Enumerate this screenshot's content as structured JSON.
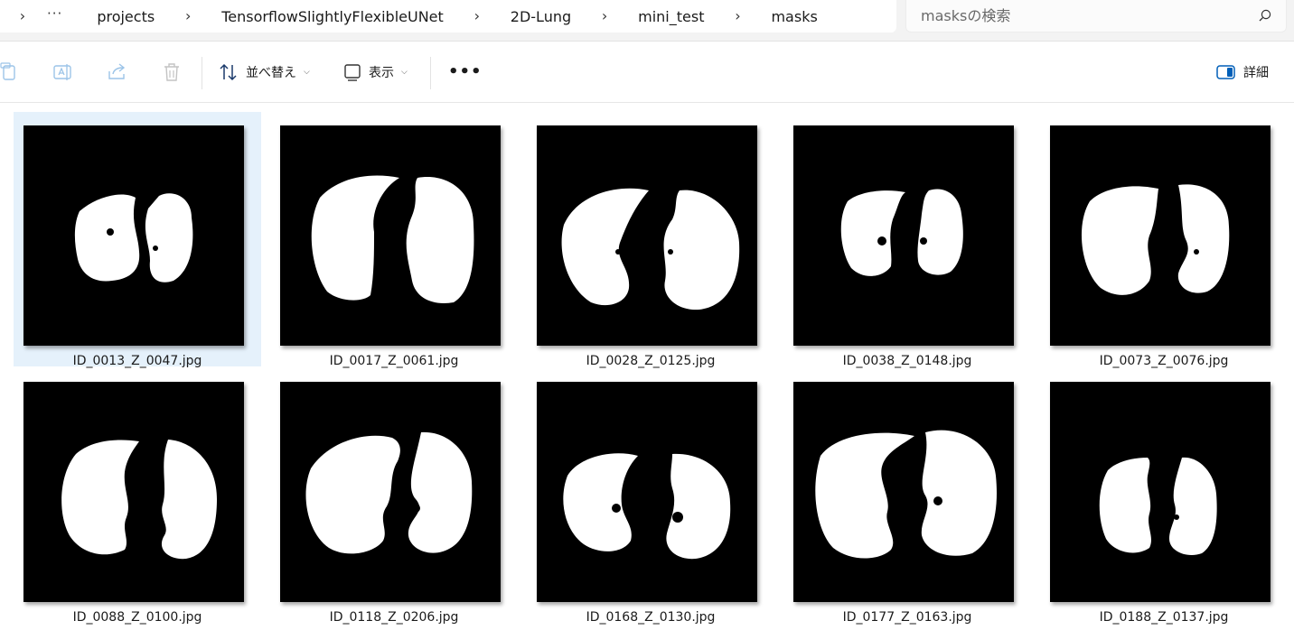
{
  "breadcrumb": {
    "overflow": "···",
    "segments": [
      "projects",
      "TensorflowSlightlyFlexibleUNet",
      "2D-Lung",
      "mini_test",
      "masks"
    ]
  },
  "search": {
    "placeholder": "masksの検索",
    "icon": "search-icon"
  },
  "toolbar": {
    "sort_label": "並べ替え",
    "view_label": "表示",
    "details_label": "詳細",
    "icons": [
      "copy-icon",
      "rename-icon",
      "share-icon",
      "delete-icon",
      "sort-icon",
      "view-icon",
      "more-icon",
      "details-pane-icon"
    ]
  },
  "files": [
    {
      "name": "ID_0013_Z_0047.jpg",
      "selected": true
    },
    {
      "name": "ID_0017_Z_0061.jpg",
      "selected": false
    },
    {
      "name": "ID_0028_Z_0125.jpg",
      "selected": false
    },
    {
      "name": "ID_0038_Z_0148.jpg",
      "selected": false
    },
    {
      "name": "ID_0073_Z_0076.jpg",
      "selected": false
    },
    {
      "name": "ID_0088_Z_0100.jpg",
      "selected": false
    },
    {
      "name": "ID_0118_Z_0206.jpg",
      "selected": false
    },
    {
      "name": "ID_0168_Z_0130.jpg",
      "selected": false
    },
    {
      "name": "ID_0177_Z_0163.jpg",
      "selected": false
    },
    {
      "name": "ID_0188_Z_0137.jpg",
      "selected": false
    }
  ],
  "colors": {
    "selection": "#e5f1fb",
    "accent": "#005fb8",
    "thumb_bg": "#000000",
    "mask": "#ffffff"
  }
}
